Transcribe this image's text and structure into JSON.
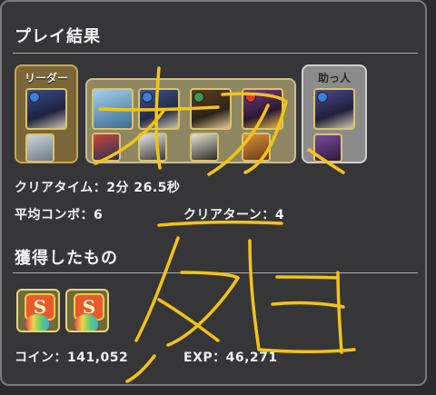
{
  "result": {
    "title": "プレイ結果",
    "clear_time_label": "クリアタイム：",
    "clear_time_value": "2分 26.5秒",
    "avg_combo_label": "平均コンボ：",
    "avg_combo_value": "6",
    "clear_turn_label": "クリアターン：",
    "clear_turn_value": "4"
  },
  "team": {
    "leader_label": "リーダー",
    "helper_label": "助っ人"
  },
  "acquired": {
    "title": "獲得したもの",
    "reward_badge": "S",
    "coin_label": "コイン：",
    "coin_value": "141,052",
    "exp_label": "EXP：",
    "exp_value": "46,271"
  },
  "colors": {
    "panel_bg": "#363638",
    "leader_frame": "#c8a84b",
    "helper_frame": "#cfcfcf",
    "scribble": "#f2c416"
  },
  "icons": [
    "monster-card-icon",
    "skill-orb-icon",
    "reward-item-icon"
  ]
}
